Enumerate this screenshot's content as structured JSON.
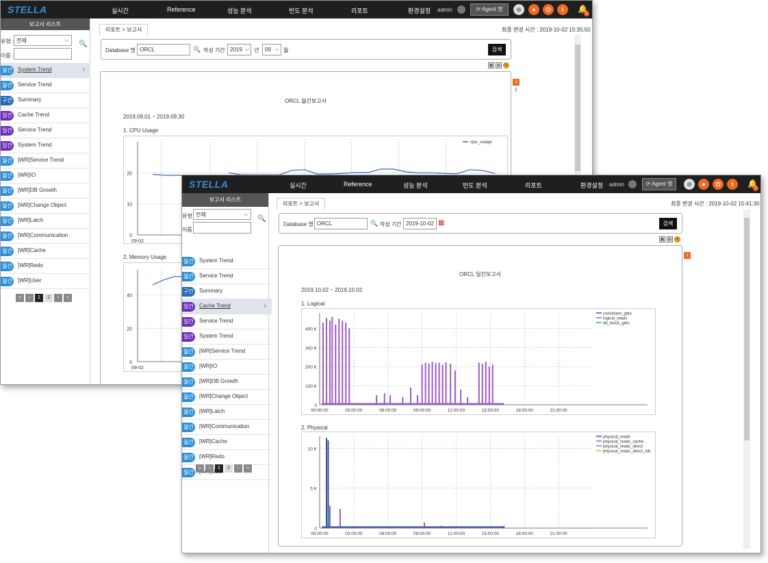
{
  "app": {
    "logo": "STELL",
    "logo_mark": "A",
    "nav": [
      "실시간",
      "Reference",
      "성능 분석",
      "빈도 분석",
      "리포트",
      "환경설정"
    ],
    "user": "admin",
    "agent_button": "Agent 명",
    "bell_count": "1",
    "icon_names": [
      "globe-icon",
      "user-icon",
      "power-icon",
      "info-icon",
      "bell-icon"
    ]
  },
  "sidebar": {
    "title": "보고서 리스트",
    "type_label": "유형 :",
    "type_value": "전체",
    "name_label": "이름 :",
    "name_value": "",
    "pager": [
      "«",
      "‹",
      "1",
      "2",
      "›",
      "»"
    ]
  },
  "window1": {
    "breadcrumb": "리포트 > 보고서",
    "modified": "최종 변경 시간 : 2019-10-02 15:35:50",
    "db_label": "Database 명",
    "db_value": "ORCL",
    "period_label": "작성 기간",
    "year": "2019",
    "year_unit": "년",
    "month": "09",
    "month_unit": "월",
    "search_button": "검색",
    "items": [
      {
        "badge": "월간",
        "label": "System Trend",
        "color": "#2f8fd6"
      },
      {
        "badge": "월간",
        "label": "Service Trend",
        "color": "#2f8fd6"
      },
      {
        "badge": "구간",
        "label": "Summary",
        "color": "#2869b8"
      },
      {
        "badge": "일간",
        "label": "Cache Trend",
        "color": "#6a2fb8"
      },
      {
        "badge": "일간",
        "label": "Service Trend",
        "color": "#6a2fb8"
      },
      {
        "badge": "일간",
        "label": "System Trend",
        "color": "#6a2fb8"
      },
      {
        "badge": "월간",
        "label": "[WR]Service Trend",
        "color": "#2f8fd6"
      },
      {
        "badge": "월간",
        "label": "[WR]IO",
        "color": "#2f8fd6"
      },
      {
        "badge": "월간",
        "label": "[WR]DB Growth",
        "color": "#2f8fd6"
      },
      {
        "badge": "월간",
        "label": "[WR]Change Object",
        "color": "#2f8fd6"
      },
      {
        "badge": "월간",
        "label": "[WR]Latch",
        "color": "#2f8fd6"
      },
      {
        "badge": "월간",
        "label": "[WR]Communication",
        "color": "#2f8fd6"
      },
      {
        "badge": "월간",
        "label": "[WR]Cache",
        "color": "#2f8fd6"
      },
      {
        "badge": "월간",
        "label": "[WR]Redo",
        "color": "#2f8fd6"
      },
      {
        "badge": "월간",
        "label": "[WR]User",
        "color": "#2f8fd6"
      }
    ],
    "report_title": "ORCL 월간보고서",
    "report_period": "2019.09.01 ~ 2019.09.30",
    "section1": "1. CPU Usage",
    "section2": "2. Memory Usage",
    "pages": [
      "1",
      "2"
    ]
  },
  "window2": {
    "breadcrumb": "리포트 > 보고서",
    "modified": "최종 변경 시간 : 2019-10-02 15:41:30",
    "db_label": "Database 명",
    "db_value": "ORCL",
    "period_label": "작성 기간",
    "date_value": "2019-10-02",
    "search_button": "검색",
    "items": [
      {
        "badge": "월간",
        "label": "System Trend",
        "color": "#2f8fd6"
      },
      {
        "badge": "월간",
        "label": "Service Trend",
        "color": "#2f8fd6"
      },
      {
        "badge": "구간",
        "label": "Summary",
        "color": "#2869b8"
      },
      {
        "badge": "일간",
        "label": "Cache Trend",
        "color": "#6a2fb8"
      },
      {
        "badge": "일간",
        "label": "Service Trend",
        "color": "#6a2fb8"
      },
      {
        "badge": "일간",
        "label": "System Trend",
        "color": "#6a2fb8"
      },
      {
        "badge": "월간",
        "label": "[WR]Service Trend",
        "color": "#2f8fd6"
      },
      {
        "badge": "월간",
        "label": "[WR]IO",
        "color": "#2f8fd6"
      },
      {
        "badge": "월간",
        "label": "[WR]DB Growth",
        "color": "#2f8fd6"
      },
      {
        "badge": "월간",
        "label": "[WR]Change Object",
        "color": "#2f8fd6"
      },
      {
        "badge": "월간",
        "label": "[WR]Latch",
        "color": "#2f8fd6"
      },
      {
        "badge": "월간",
        "label": "[WR]Communication",
        "color": "#2f8fd6"
      },
      {
        "badge": "월간",
        "label": "[WR]Cache",
        "color": "#2f8fd6"
      },
      {
        "badge": "월간",
        "label": "[WR]Redo",
        "color": "#2f8fd6"
      },
      {
        "badge": "월간",
        "label": "[WR]User",
        "color": "#2f8fd6"
      }
    ],
    "report_title": "ORCL 일간보고서",
    "report_period": "2019.10.02 ~ 2019.10.02",
    "section1": "1. Logical",
    "section2": "2. Physical",
    "pages": [
      "1"
    ]
  },
  "chart_data": [
    {
      "type": "line",
      "title": "1. CPU Usage",
      "x_tick_labels": [
        "09-02"
      ],
      "yticks": [
        0,
        10,
        20
      ],
      "ylim": [
        0,
        30
      ],
      "series": [
        {
          "name": "cpu_usage",
          "color": "#3a63b8",
          "values": [
            19.5,
            19.2,
            19.2,
            19.2,
            null,
            null,
            20.0,
            19.4,
            19.4,
            19.4,
            19.4,
            20.8,
            21.0,
            19.6,
            19.6,
            19.8,
            20.1,
            20.1,
            21.2,
            21.2,
            20.3,
            20.0,
            20.0,
            19.8,
            19.7,
            21.0,
            20.8,
            19.8
          ]
        }
      ]
    },
    {
      "type": "line",
      "title": "2. Memory Usage",
      "x_tick_labels": [
        "09-02"
      ],
      "yticks": [
        0,
        20,
        40
      ],
      "ylim": [
        0,
        55
      ],
      "series": [
        {
          "name": "",
          "color": "#3a63b8",
          "values": [
            46,
            49,
            51,
            51,
            51
          ]
        }
      ]
    },
    {
      "type": "bar",
      "title": "1. Logical",
      "x_tick_labels": [
        "00:00:00",
        "03:00:00",
        "06:00:00",
        "09:00:00",
        "12:00:00",
        "15:00:00",
        "18:00:00",
        "21:00:00"
      ],
      "yticks": [
        "0",
        "100 K",
        "200 K",
        "300 K",
        "400 K"
      ],
      "ylim": [
        0,
        480000
      ],
      "series": [
        {
          "name": "consistent_gets",
          "color": "#3a4fa0"
        },
        {
          "name": "logical_reads",
          "color": "#9b59c9",
          "spikes": [
            [
              0.3,
              430000
            ],
            [
              0.6,
              455000
            ],
            [
              0.9,
              440000
            ],
            [
              1.1,
              460000
            ],
            [
              1.4,
              420000
            ],
            [
              1.7,
              450000
            ],
            [
              2.0,
              440000
            ],
            [
              2.3,
              430000
            ],
            [
              2.6,
              400000
            ],
            [
              5.0,
              50000
            ],
            [
              5.7,
              60000
            ],
            [
              6.2,
              50000
            ],
            [
              7.3,
              40000
            ],
            [
              8.0,
              90000
            ],
            [
              8.6,
              50000
            ],
            [
              9.0,
              210000
            ],
            [
              9.3,
              220000
            ],
            [
              9.6,
              215000
            ],
            [
              9.9,
              225000
            ],
            [
              10.2,
              218000
            ],
            [
              10.5,
              220000
            ],
            [
              10.8,
              210000
            ],
            [
              11.1,
              222000
            ],
            [
              11.5,
              215000
            ],
            [
              11.9,
              180000
            ],
            [
              12.4,
              80000
            ],
            [
              13.0,
              40000
            ],
            [
              14.0,
              220000
            ],
            [
              14.3,
              215000
            ],
            [
              14.6,
              225000
            ],
            [
              14.9,
              200000
            ],
            [
              15.2,
              210000
            ]
          ]
        },
        {
          "name": "db_block_gets",
          "color": "#2aa79b"
        }
      ]
    },
    {
      "type": "bar",
      "title": "2. Physical",
      "x_tick_labels": [
        "00:00:00",
        "03:00:00",
        "06:00:00",
        "09:00:00",
        "12:00:00",
        "15:00:00",
        "18:00:00",
        "21:00:00"
      ],
      "yticks": [
        "0",
        "5 K",
        "10 K"
      ],
      "ylim": [
        0,
        11500
      ],
      "series": [
        {
          "name": "physical_reads",
          "color": "#3a4fa0",
          "spikes": [
            [
              0.6,
              11300
            ],
            [
              0.75,
              11000
            ]
          ]
        },
        {
          "name": "physical_reads_cache",
          "color": "#9b59c9",
          "spikes": [
            [
              0.9,
              2800
            ],
            [
              1.8,
              2400
            ],
            [
              9.2,
              700
            ],
            [
              10.7,
              300
            ],
            [
              16.2,
              300
            ]
          ]
        },
        {
          "name": "physical_reads_direct",
          "color": "#2aa79b",
          "spikes": [
            [
              0.8,
              2200
            ]
          ]
        },
        {
          "name": "physical_reads_direct_lob",
          "color": "#b5c23a"
        }
      ]
    }
  ]
}
